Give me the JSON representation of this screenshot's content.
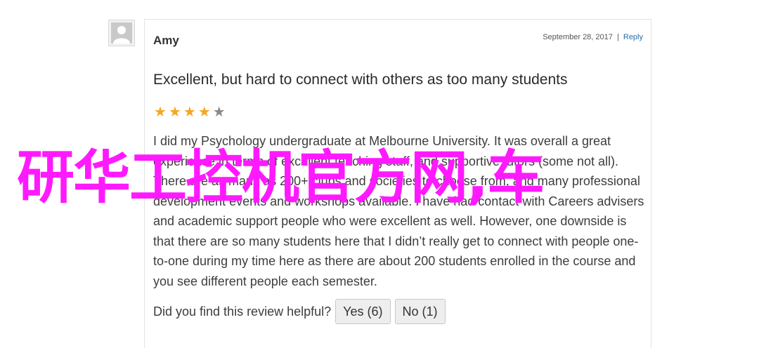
{
  "review": {
    "author": "Amy",
    "date": "September 28, 2017",
    "separator": "|",
    "reply_label": "Reply",
    "avatar_icon": "user-silhouette-icon",
    "title": "Excellent, but hard to connect with others as too many students",
    "rating": 4,
    "rating_max": 5,
    "star_color": "#f5a623",
    "body": "I did my Psychology undergraduate at Melbourne University. It was overall a great experience in terms of excellent teaching staff, and supportive tutors (some not all). There are as many as 200+ clubs and societies to choose from, and many professional development events and workshops available. I have had contact with Careers advisers and academic support people who were excellent as well. However, one downside is that there are so many students here that I didn’t really get to connect with people one-to-one during my time here as there are about 200 students enrolled in the course and you see different people each semester.",
    "helpful_question": "Did you find this review helpful?",
    "yes_label": "Yes (6)",
    "no_label": "No (1)"
  },
  "watermark": {
    "text": "研华工控机官方网,车",
    "color": "#ff19ff"
  }
}
